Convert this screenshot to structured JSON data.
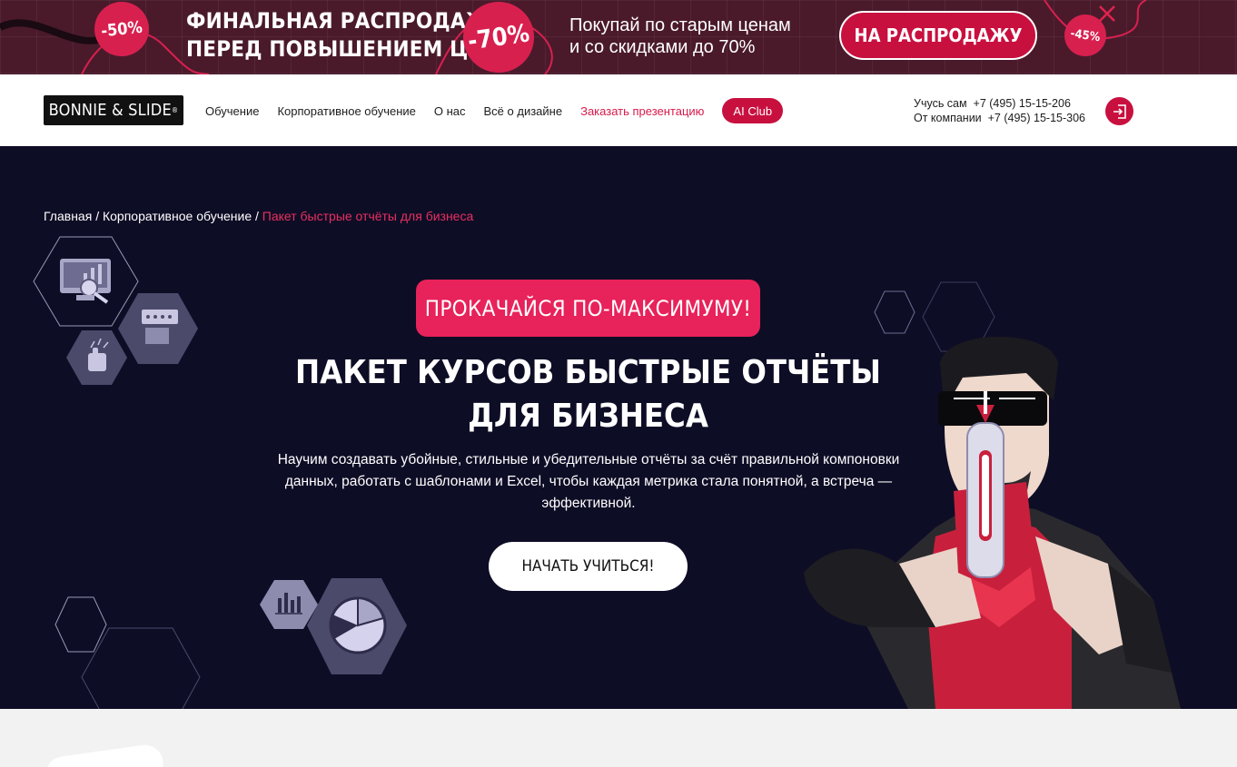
{
  "promo": {
    "badge_left": "-50%",
    "title_line1": "ФИНАЛЬНАЯ РАСПРОДАЖА",
    "title_line2": "ПЕРЕД ПОВЫШЕНИЕМ ЦЕН",
    "badge_center": "-70%",
    "sub_line1": "Покупай по старым ценам",
    "sub_line2": "и со скидками до 70%",
    "button": "НА РАСПРОДАЖУ",
    "badge_right": "-45%",
    "close_icon": "close-icon",
    "colors": {
      "background": "#4a1a2b",
      "accent": "#d8204f"
    }
  },
  "header": {
    "logo": "BONNIE & SLIDE",
    "logo_mark": "®",
    "nav": [
      "Обучение",
      "Корпоративное обучение",
      "О нас",
      "Всё о дизайне",
      "Заказать презентацию"
    ],
    "ai_club": "AI Club",
    "contact_self_label": "Учусь сам",
    "contact_self_phone": "+7 (495) 15-15-206",
    "contact_company_label": "От компании",
    "contact_company_phone": "+7 (495) 15-15-306",
    "login_icon": "login-icon"
  },
  "hero": {
    "breadcrumb": {
      "home": "Главная",
      "sep": "/",
      "section": "Корпоративное обучение",
      "current": "Пакет быстрые отчёты для бизнеса"
    },
    "tag": "ПРОКАЧАЙСЯ ПО-МАКСИМУМУ!",
    "title_line1": "ПАКЕТ КУРСОВ БЫСТРЫЕ ОТЧЁТЫ",
    "title_line2": "ДЛЯ БИЗНЕСА",
    "description": "Научим создавать убойные, стильные и убедительные отчёты за счёт правильной компоновки данных, работать с шаблонами и Excel, чтобы каждая метрика стала понятной, а встреча — эффективной.",
    "cta": "НАЧАТЬ УЧИТЬСЯ!",
    "colors": {
      "background": "#0e0d26",
      "accent": "#e8225a"
    }
  }
}
